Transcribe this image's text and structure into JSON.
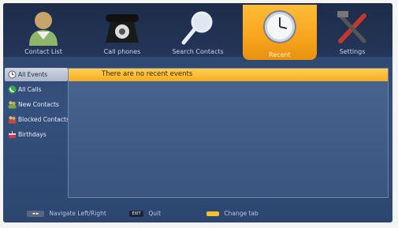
{
  "tabs": [
    {
      "label": "Contact List",
      "icon": "contact-person-icon",
      "active": false
    },
    {
      "label": "Call phones",
      "icon": "telephone-icon",
      "active": false
    },
    {
      "label": "Search Contacts",
      "icon": "magnifier-icon",
      "active": false
    },
    {
      "label": "Recent",
      "icon": "clock-icon",
      "active": true
    },
    {
      "label": "Settings",
      "icon": "tools-icon",
      "active": false
    }
  ],
  "sidebar": {
    "items": [
      {
        "label": "All Events",
        "icon": "clock-small-icon",
        "selected": true
      },
      {
        "label": "All Calls",
        "icon": "phone-green-icon",
        "selected": false
      },
      {
        "label": "New Contacts",
        "icon": "people-icon",
        "selected": false
      },
      {
        "label": "Blocked Contacts",
        "icon": "blocked-people-icon",
        "selected": false
      },
      {
        "label": "Birthdays",
        "icon": "cake-icon",
        "selected": false
      }
    ]
  },
  "main": {
    "message": "There are no recent events"
  },
  "footer": {
    "navigate": {
      "label": "Navigate Left/Right"
    },
    "quit": {
      "key": "EXIT",
      "label": "Quit"
    },
    "change_tab": {
      "label": "Change tab"
    }
  },
  "colors": {
    "accent": "#f7a51b",
    "background": "#34507c",
    "selected_item": "#cfd6e2"
  }
}
